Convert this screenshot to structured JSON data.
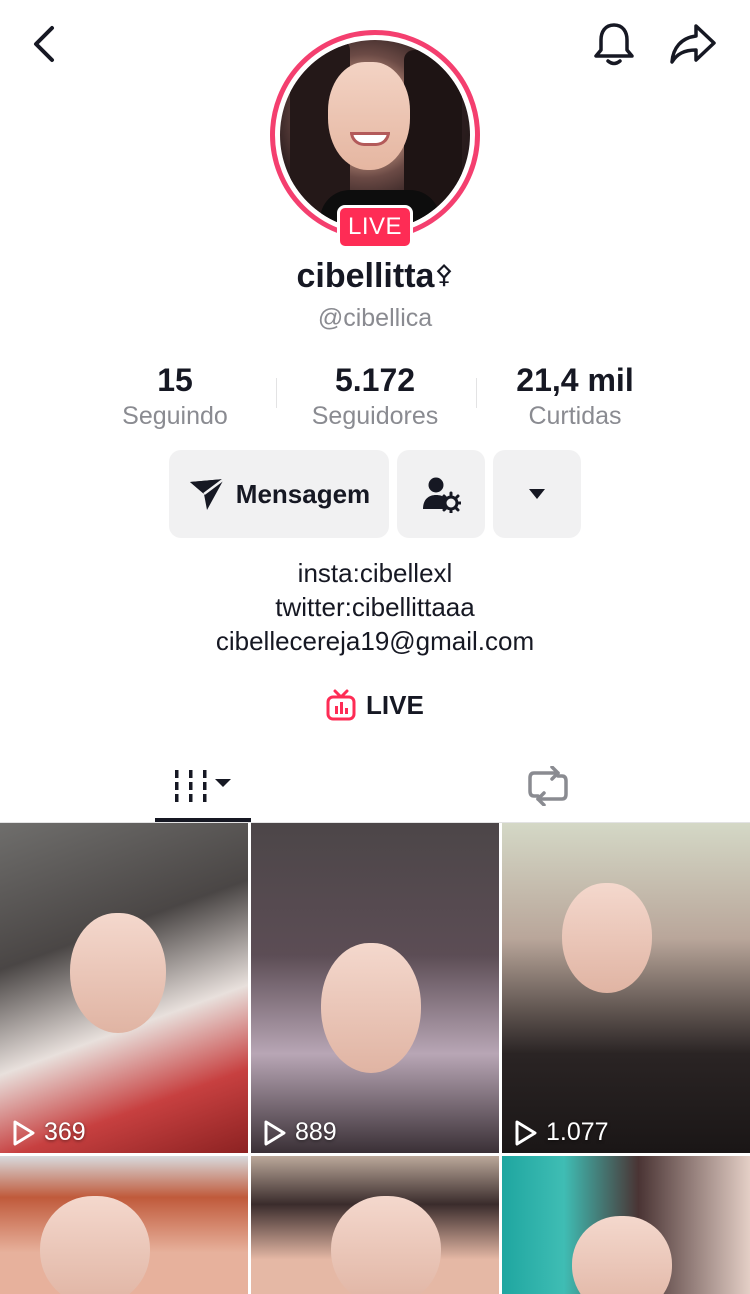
{
  "profile": {
    "display_name": "cibellitta",
    "name_emoji": "⚴",
    "username": "@cibellica",
    "live_badge": "LIVE",
    "ring_color": "#f43f6f"
  },
  "stats": [
    {
      "value": "15",
      "label": "Seguindo"
    },
    {
      "value": "5.172",
      "label": "Seguidores"
    },
    {
      "value": "21,4 mil",
      "label": "Curtidas"
    }
  ],
  "actions": {
    "message_label": "Mensagem",
    "message_icon": "send-plane-icon",
    "friend_icon": "user-settings-icon",
    "more_icon": "caret-down-icon"
  },
  "bio": {
    "line1": "insta:cibellexl",
    "line2": "twitter:cibellittaaa",
    "line3": "cibellecereja19@gmail.com"
  },
  "live_link": {
    "label": "LIVE",
    "icon": "tv-live-icon",
    "color": "#fe2c55"
  },
  "tabs": [
    {
      "icon": "videos-grid-icon",
      "selected": true
    },
    {
      "icon": "repost-icon",
      "selected": false
    }
  ],
  "videos": [
    {
      "views": "369"
    },
    {
      "views": "889"
    },
    {
      "views": "1.077"
    },
    {
      "views": ""
    },
    {
      "views": ""
    },
    {
      "views": ""
    }
  ],
  "header_icons": [
    "back-chevron-icon",
    "bell-icon",
    "share-arrow-icon"
  ]
}
